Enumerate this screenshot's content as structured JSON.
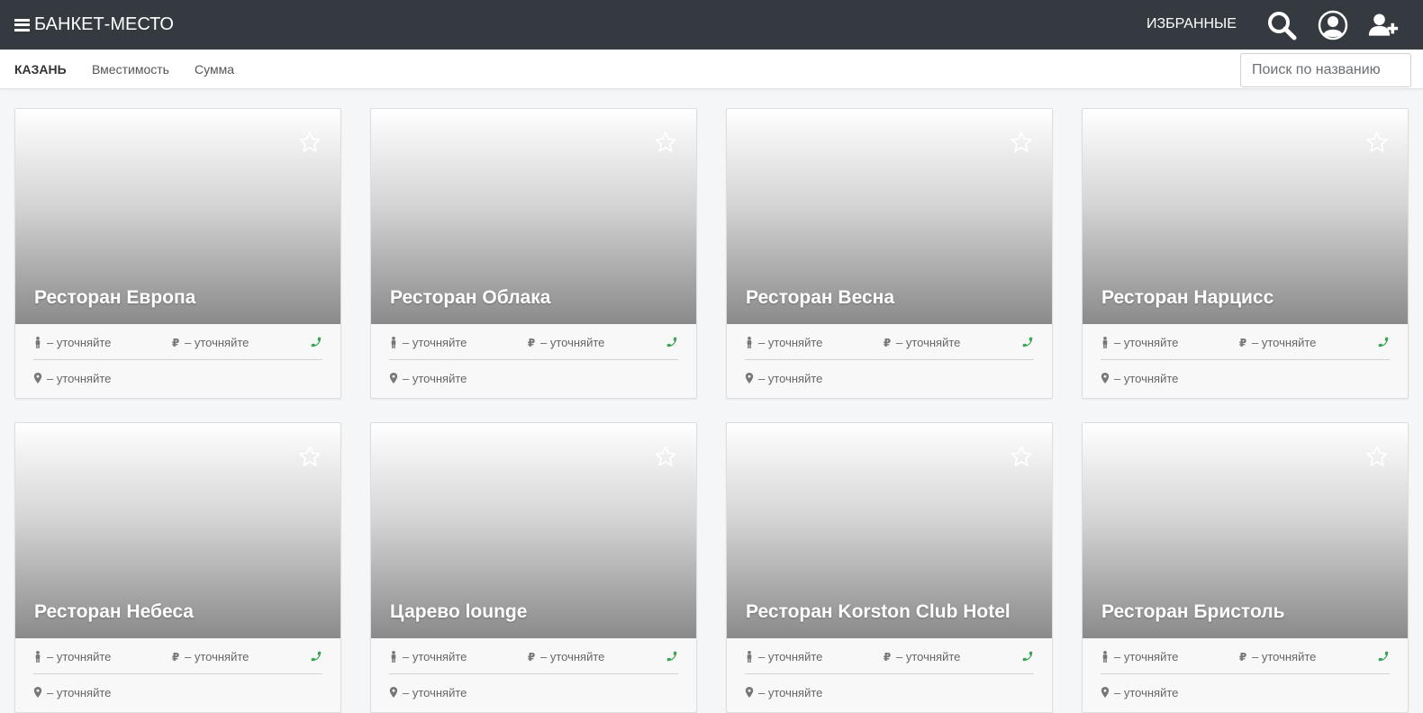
{
  "header": {
    "brand": "БАНКЕТ-МЕСТО",
    "favorites_label": "ИЗБРАННЫЕ",
    "icons": [
      "menu-icon",
      "search-icon",
      "user-icon",
      "add-user-icon"
    ]
  },
  "filters": {
    "city": "КАЗАНЬ",
    "capacity": "Вместимость",
    "sum": "Сумма",
    "search_placeholder": "Поиск по названию"
  },
  "colors": {
    "topbar": "#343a40",
    "phone": "#3aa655"
  },
  "cards": [
    {
      "title": "Ресторан Европа",
      "capacity": "– уточняйте",
      "price": "– уточняйте",
      "address": "– уточняйте"
    },
    {
      "title": "Ресторан Облака",
      "capacity": "– уточняйте",
      "price": "– уточняйте",
      "address": "– уточняйте"
    },
    {
      "title": "Ресторан Весна",
      "capacity": "– уточняйте",
      "price": "– уточняйте",
      "address": "– уточняйте"
    },
    {
      "title": "Ресторан Нарцисс",
      "capacity": "– уточняйте",
      "price": "– уточняйте",
      "address": "– уточняйте"
    },
    {
      "title": "Ресторан Небеса",
      "capacity": "– уточняйте",
      "price": "– уточняйте",
      "address": "– уточняйте"
    },
    {
      "title": "Царево lounge",
      "capacity": "– уточняйте",
      "price": "– уточняйте",
      "address": "– уточняйте"
    },
    {
      "title": "Ресторан Korston Club Hotel",
      "capacity": "– уточняйте",
      "price": "– уточняйте",
      "address": "– уточняйте"
    },
    {
      "title": "Ресторан Бристоль",
      "capacity": "– уточняйте",
      "price": "– уточняйте",
      "address": "– уточняйте"
    }
  ]
}
